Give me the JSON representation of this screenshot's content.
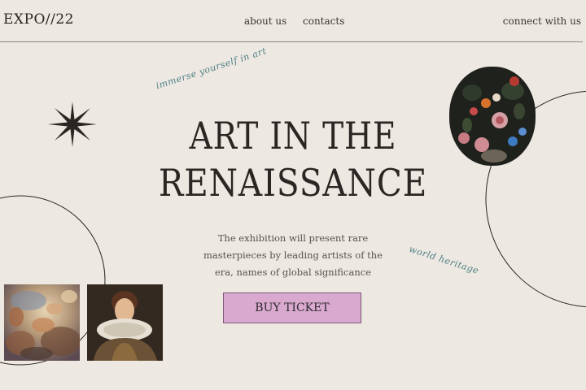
{
  "header": {
    "logo": "EXPO//22",
    "nav": {
      "about": "about us",
      "contacts": "contacts"
    },
    "connect": "connect with us"
  },
  "decor": {
    "tagline_1": "immerse yourself in art",
    "tagline_2": "world heritage",
    "star_icon": "eight-point-star"
  },
  "hero": {
    "title_line_1": "ART IN THE",
    "title_line_2": "RENAISSANCE",
    "description": "The exhibition will present rare masterpieces by leading artists of the era, names of global significance",
    "cta": "BUY TICKET"
  },
  "colors": {
    "background": "#ede8e1",
    "text": "#2a2623",
    "accent_script": "#4d7f86",
    "button": "#d9a9cf"
  }
}
